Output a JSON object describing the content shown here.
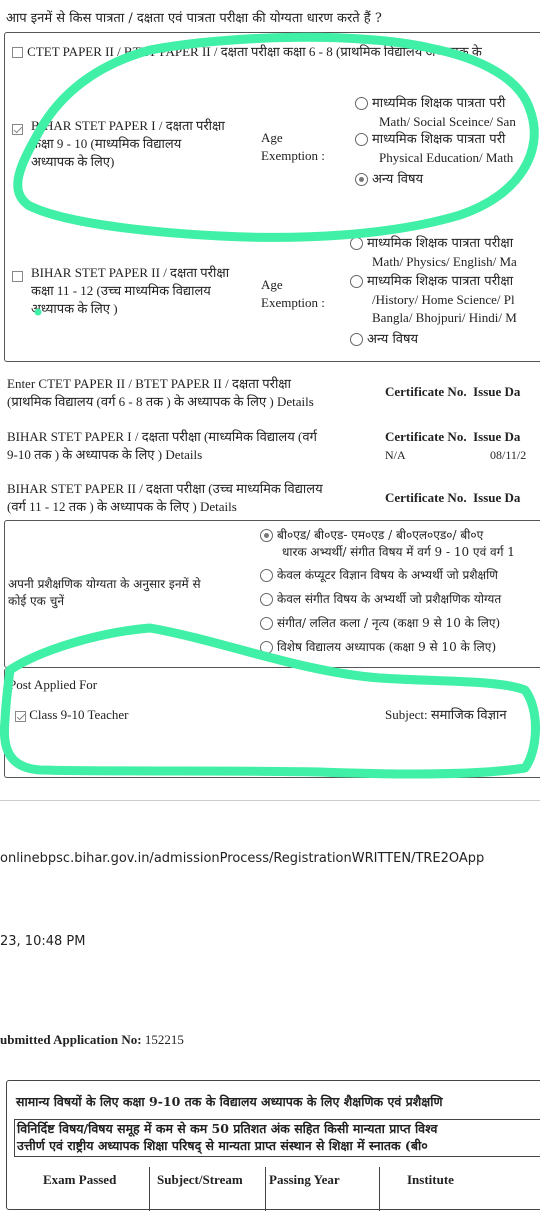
{
  "eligibility": {
    "question": "आप इनमें से किस पात्रता / दक्षता एवं पात्रता परीक्षा की योग्यता धारण करते हैं ?",
    "ctet_row": {
      "label": "CTET PAPER II / BTET PAPER II / दक्षता परीक्षा कक्षा 6 - 8 (प्राथमिक विद्यालय अध्यापक के",
      "checked": false
    },
    "stet1_row": {
      "label_line1": "BIHAR STET PAPER I / दक्षता परीक्षा",
      "label_line2": "कक्षा 9 - 10 (माध्यमिक विद्यालय",
      "label_line3": "अध्यापक के लिए)",
      "checked": true,
      "age_label_1": "Age",
      "age_label_2": "Exemption :",
      "options": [
        {
          "line1": "माध्यमिक शिक्षक पात्रता परी",
          "line2": "Math/ Social Sceince/ San",
          "selected": false
        },
        {
          "line1": "माध्यमिक शिक्षक पात्रता परी",
          "line2": "Physical Education/ Math",
          "selected": false
        },
        {
          "line1": "अन्य विषय",
          "line2": "",
          "selected": true
        }
      ]
    },
    "stet2_row": {
      "label_line1": "BIHAR STET PAPER II / दक्षता परीक्षा",
      "label_line2": "कक्षा 11 - 12 (उच्च माध्यमिक विद्यालय",
      "label_line3": "अध्यापक के लिए )",
      "checked": false,
      "age_label_1": "Age",
      "age_label_2": "Exemption :",
      "options": [
        {
          "line1": "माध्यमिक शिक्षक पात्रता परीक्षा",
          "line2": "Math/ Physics/ English/ Ma",
          "selected": false
        },
        {
          "line1": "माध्यमिक शिक्षक पात्रता परीक्षा",
          "line2": "/History/ Home Science/ Pl",
          "line3": "Bangla/ Bhojpuri/ Hindi/ M",
          "selected": false
        },
        {
          "line1": "अन्य विषय",
          "line2": "",
          "selected": false
        }
      ]
    }
  },
  "certificates": {
    "header_cert": "Certificate No.",
    "header_issue": "Issue Da",
    "rows": [
      {
        "line1": "Enter CTET PAPER II / BTET PAPER II / दक्षता परीक्षा",
        "line2": "(प्राथमिक विद्यालय (वर्ग 6 - 8 तक ) के अध्यापक के लिए ) Details",
        "cert": "",
        "issue": ""
      },
      {
        "line1": "BIHAR STET PAPER I / दक्षता परीक्षा (माध्यमिक विद्यालय (वर्ग",
        "line2": "9-10 तक ) के अध्यापक के लिए ) Details",
        "cert": "N/A",
        "issue": "08/11/2"
      },
      {
        "line1": "BIHAR STET PAPER II / दक्षता परीक्षा (उच्च माध्यमिक विद्यालय",
        "line2": "(वर्ग 11 - 12 तक ) के अध्यापक के लिए ) Details",
        "cert": "",
        "issue": ""
      }
    ]
  },
  "training": {
    "label_line1": "अपनी प्रशैक्षणिक योग्यता के अनुसार इनमें से",
    "label_line2": "कोई एक चुनें",
    "options": [
      {
        "line1": "बी०एड/ बी०एड- एम०एड / बी०एल०एड०/ बी०ए",
        "line2": "धारक अभ्यर्थी/ संगीत विषय में वर्ग 9 - 10 एवं वर्ग 1",
        "selected": true
      },
      {
        "line1": "केवल कंप्यूटर विज्ञान विषय के अभ्यर्थी जो प्रशैक्षणि",
        "line2": "",
        "selected": false
      },
      {
        "line1": "केवल संगीत विषय के अभ्यर्थी जो प्रशैक्षणिक योग्यत",
        "line2": "",
        "selected": false
      },
      {
        "line1": "संगीत/ ललित कला / नृत्य (कक्षा 9 से 10 के लिए)",
        "line2": "",
        "selected": false
      },
      {
        "line1": "विशेष विद्यालय अध्यापक (कक्षा 9 से 10 के लिए)",
        "line2": "",
        "selected": false
      }
    ]
  },
  "post": {
    "title": "Post Applied For",
    "class_label": "Class 9-10 Teacher",
    "class_checked": true,
    "subject": "Subject: समाजिक विज्ञान"
  },
  "print_footer": {
    "url": "onlinebpsc.bihar.gov.in/admissionProcess/RegistrationWRITTEN/TRE2OApp",
    "datetime": "23, 10:48 PM",
    "submitted_label": "ubmitted Application No:",
    "submitted_no": "152215"
  },
  "academic": {
    "heading": "सामान्य विषयों के लिए कक्षा 9-10 तक के विद्यालय अध्यापक के लिए शैक्षणिक एवं प्रशैक्षणि",
    "note_line1": "विनिर्दिष्ट विषय/विषय समूह में कम से कम 50 प्रतिशत अंक सहित किसी मान्यता प्राप्त विश्व",
    "note_line2": "उत्तीर्ण एवं राष्ट्रीय अध्यापक शिक्षा परिषद् से मान्यता प्राप्त संस्थान से शिक्षा में स्नातक (बी०",
    "columns": [
      "Exam Passed",
      "Subject/Stream",
      "Passing Year",
      "Institute"
    ]
  },
  "colors": {
    "highlight": "#3ff0a6",
    "border": "#555555"
  }
}
